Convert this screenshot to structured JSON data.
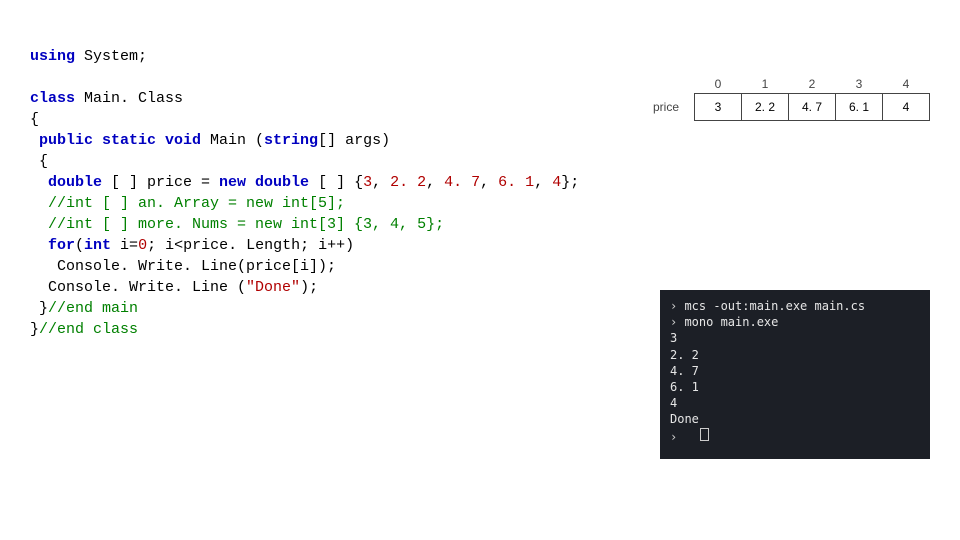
{
  "code": {
    "l01a": "using",
    "l01b": " System;",
    "blank1": "",
    "l02a": "class",
    "l02b": " Main. Class",
    "l03": "{",
    "l04": " public static void",
    "l04b": " Main (",
    "l04c": "string",
    "l04d": "[] args)",
    "l05": " {",
    "l06a": "  double",
    "l06b": " [ ] price = ",
    "l06c": "new double",
    "l06d": " [ ] {",
    "l06n1": "3",
    "l06c1": ", ",
    "l06n2": "2. 2",
    "l06c2": ", ",
    "l06n3": "4. 7",
    "l06c3": ", ",
    "l06n4": "6. 1",
    "l06c4": ", ",
    "l06n5": "4",
    "l06e": "};",
    "l07": "  //int [ ] an. Array = new int[5];",
    "l08": "  //int [ ] more. Nums = new int[3] {3, 4, 5};",
    "l09a": "  for",
    "l09b": "(",
    "l09c": "int",
    "l09d": " i=",
    "l09n0": "0",
    "l09e": "; i<price. Length; i++)",
    "l10": "   Console. Write. Line(price[i]);",
    "l11a": "  Console. Write. Line (",
    "l11s": "\"Done\"",
    "l11b": ");",
    "l12": " }",
    "l12c": "//end main",
    "l13": "}",
    "l13c": "//end class"
  },
  "diagram": {
    "label": "price",
    "indices": [
      "0",
      "1",
      "2",
      "3",
      "4"
    ],
    "values": [
      "3",
      "2. 2",
      "4. 7",
      "6. 1",
      "4"
    ]
  },
  "terminal": {
    "p1": "mcs -out:main.exe main.cs",
    "p2": "mono main.exe",
    "o1": "3",
    "o2": "2. 2",
    "o3": "4. 7",
    "o4": "6. 1",
    "o5": "4",
    "o6": "Done"
  }
}
